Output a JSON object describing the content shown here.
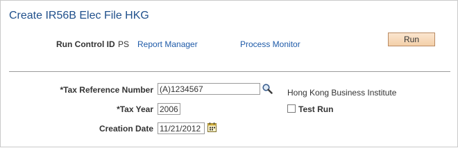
{
  "page": {
    "title": "Create IR56B Elec File HKG"
  },
  "run_control": {
    "label": "Run Control ID",
    "value": "PS",
    "report_manager_link": "Report Manager",
    "process_monitor_link": "Process Monitor",
    "run_button": "Run"
  },
  "form": {
    "tax_reference": {
      "label": "*Tax Reference Number",
      "value": "(A)1234567",
      "description": "Hong Kong Business Institute"
    },
    "tax_year": {
      "label": "*Tax Year",
      "value": "2006"
    },
    "test_run": {
      "label": "Test Run",
      "checked": false
    },
    "creation_date": {
      "label": "Creation Date",
      "value": "11/21/2012"
    }
  },
  "icons": {
    "lookup": "search-icon",
    "calendar": "calendar-icon"
  },
  "colors": {
    "title": "#1f4f8b",
    "link": "#1e5aa8",
    "button_bg": "#f3cfa8"
  }
}
